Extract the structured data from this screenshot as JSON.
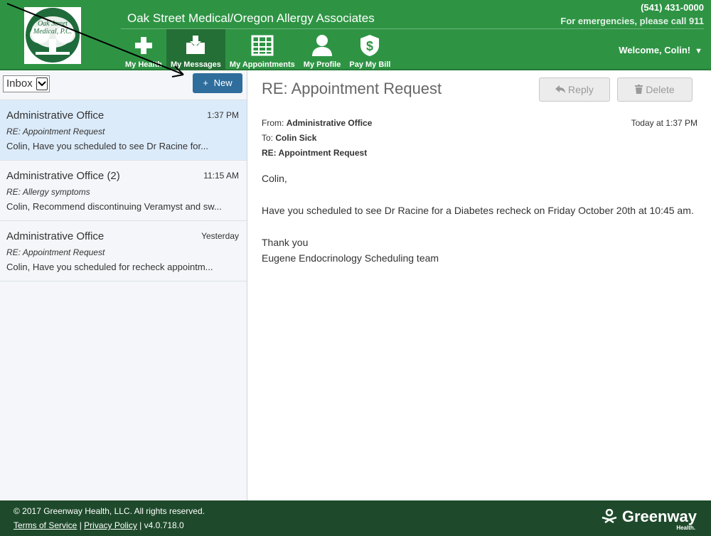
{
  "header": {
    "logo_text_line1": "Oak Street",
    "logo_text_line2": "Medical, P.C.",
    "practice_name": "Oak Street Medical/Oregon Allergy Associates",
    "phone": "(541) 431-0000",
    "emergency": "For emergencies, please call 911",
    "welcome": "Welcome, Colin!",
    "nav": [
      {
        "label": "My Health",
        "icon": "plus-icon"
      },
      {
        "label": "My Messages",
        "icon": "inbox-icon",
        "active": true
      },
      {
        "label": "My Appointments",
        "icon": "calendar-grid-icon"
      },
      {
        "label": "My Profile",
        "icon": "person-icon"
      },
      {
        "label": "Pay My Bill",
        "icon": "dollar-shield-icon"
      }
    ],
    "brand_color": "#2e9444"
  },
  "sidebar": {
    "folder": "Inbox",
    "new_button": "New",
    "new_icon": "+",
    "messages": [
      {
        "sender": "Administrative Office",
        "time": "1:37 PM",
        "subject": "RE: Appointment Request",
        "preview": "Colin, Have you scheduled to see Dr Racine for...",
        "selected": true
      },
      {
        "sender": "Administrative Office (2)",
        "time": "11:15 AM",
        "subject": "RE: Allergy symptoms",
        "preview": "Colin, Recommend discontinuing Veramyst and sw..."
      },
      {
        "sender": "Administrative Office",
        "time": "Yesterday",
        "subject": "RE: Appointment Request",
        "preview": "Colin, Have you scheduled for recheck appointm..."
      }
    ]
  },
  "message": {
    "title": "RE: Appointment Request",
    "reply_label": "Reply",
    "delete_label": "Delete",
    "from_label": "From:",
    "from": "Administrative Office",
    "to_label": "To:",
    "to": "Colin Sick",
    "subject": "RE: Appointment Request",
    "date": "Today at 1:37 PM",
    "body": [
      "Colin,",
      "Have you scheduled to see Dr Racine for a Diabetes recheck on Friday October 20th at 10:45 am.",
      "Thank you",
      "Eugene Endocrinology Scheduling team"
    ]
  },
  "footer": {
    "copyright": "© 2017 Greenway Health, LLC. All rights reserved.",
    "terms": "Terms of Service",
    "privacy": "Privacy Policy",
    "version": "v4.0.718.0",
    "brand": "Greenway",
    "brand_sub": "Health."
  }
}
